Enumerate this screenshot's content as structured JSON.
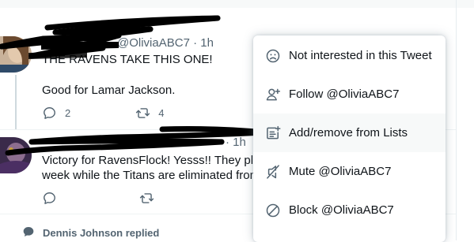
{
  "tweets": [
    {
      "header_visible": "@OliviaABC7 · 1h",
      "text_line1": "THE RAVENS TAKE THIS ONE!",
      "text_line2": "Good for Lamar Jackson.",
      "reply_count": "2",
      "retweet_count": "4"
    },
    {
      "header_visible": "· 1h",
      "text_line1": "Victory for RavensFlock! Yesss!! They play",
      "text_line2": "week while the Titans are eliminated from"
    }
  ],
  "replied_context": "Dennis Johnson replied",
  "menu": {
    "items": [
      {
        "label": "Not interested in this Tweet",
        "icon": "frown-face-icon"
      },
      {
        "label": "Follow @OliviaABC7",
        "icon": "follow-user-icon"
      },
      {
        "label": "Add/remove from Lists",
        "icon": "list-add-icon"
      },
      {
        "label": "Mute @OliviaABC7",
        "icon": "mute-speaker-icon"
      },
      {
        "label": "Block @OliviaABC7",
        "icon": "block-icon"
      }
    ]
  },
  "colors": {
    "text_primary": "#0f1419",
    "text_secondary": "#536471",
    "menu_hover": "#f7f9f9",
    "divider": "#eff3f4"
  }
}
